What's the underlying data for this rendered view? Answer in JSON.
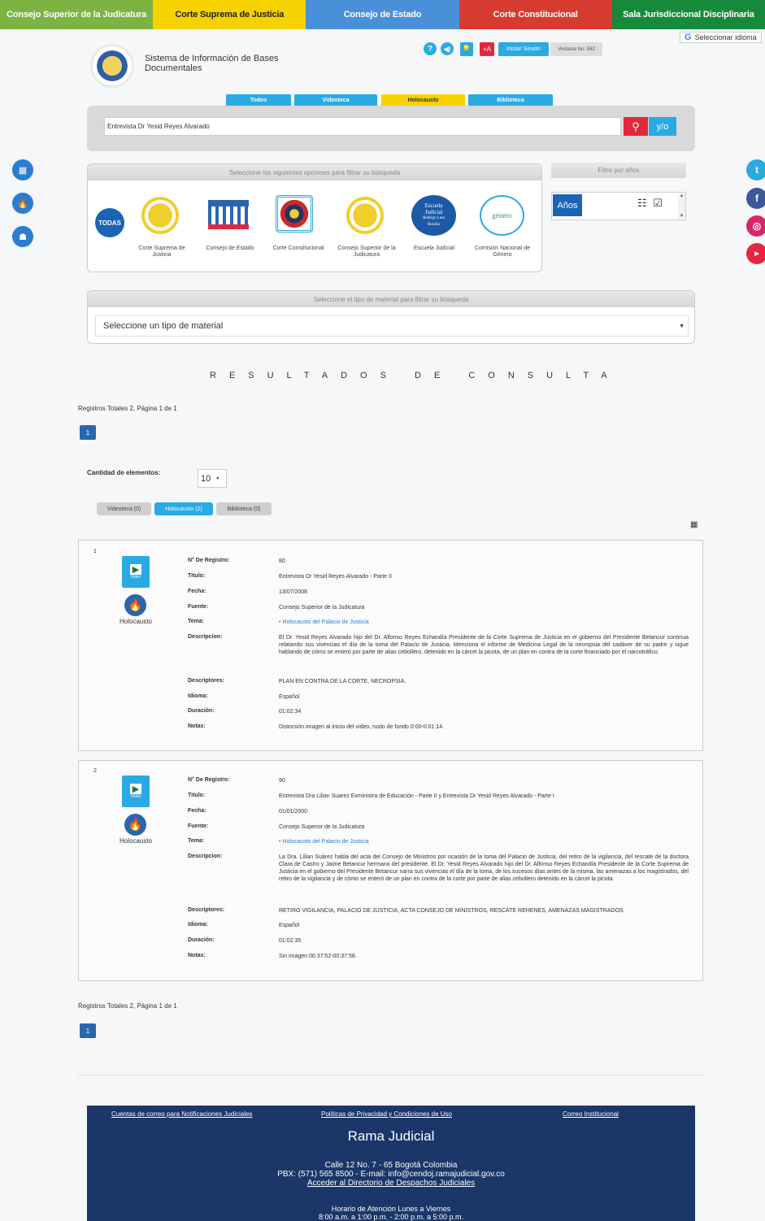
{
  "topbar": [
    {
      "label": "Consejo Superior de la Judicatura",
      "color": "#7cb342"
    },
    {
      "label": "Corte Suprema de Justicia",
      "color": "#f6d200"
    },
    {
      "label": "Consejo de Estado",
      "color": "#4a90d9"
    },
    {
      "label": "Corte Constitucional",
      "color": "#d73a2f"
    },
    {
      "label": "Sala Jurisdiccional Disciplinaria",
      "color": "#168a3a"
    }
  ],
  "lang_selector": "Seleccionar idioma",
  "header": {
    "title_line1": "Sistema de Información de Bases",
    "title_line2": "Documentales"
  },
  "toolbar": {
    "font_btn": "+A",
    "login": "Iniciar Sesión",
    "visitors": "Visitante No: 582"
  },
  "tabs": [
    "Todos",
    "Videoteca",
    "Holocausto",
    "Biblioteca"
  ],
  "search": {
    "value": "Entrevista Dr Yesid Reyes Alvarado",
    "andor": "y/o"
  },
  "filters": {
    "heading": "Seleccione los siguientes opciones para filtrar su búsqueda",
    "all": "TODAS",
    "institutions": [
      "Corte Suprema de Justicia",
      "Consejo de Estado",
      "Corte Constitucional",
      "Consejo Superior de la Judicatura",
      "Escuela Judicial",
      "Comisión Nacional de Género"
    ],
    "escuela_logo": [
      "Escuela",
      "Judicial",
      "Rodrigo Lara",
      "Bonilla"
    ],
    "genero_logo": "género",
    "years_heading": "Filtre por años",
    "years_label": "Años"
  },
  "material": {
    "heading": "Seleccione el tipo de material para filtrar su búsqueda",
    "placeholder": "Seleccione un tipo de material"
  },
  "results": {
    "title": "RESULTADOS DE CONSULTA",
    "summary": "Registros Totales 2, Página 1 de 1",
    "page": "1",
    "qty_label": "Cantidad de elementos:",
    "qty_value": "10",
    "type_tabs": [
      "Videoteca (0)",
      "Holocausto (2)",
      "Biblioteca (0)"
    ],
    "labels": [
      "N° De Registro:",
      "Titulo:",
      "Fecha:",
      "Fuente:",
      "Tema:",
      "Descripcion:",
      "Descriptores:",
      "Idioma:",
      "Duración:",
      "Notas:"
    ],
    "video_label": "Video",
    "category": "Holocausto",
    "items": [
      {
        "num": "1",
        "registro": "80",
        "titulo": "Entrevista Dr Yesid Reyes Alvarado - Parte II",
        "fecha": "13/07/2008",
        "fuente": "Consejo Superior de la Judicatura",
        "tema": "• Holocausto del Palacio de Justicia",
        "descripcion": "El Dr. Yesid Reyes Alvarado hijo del Dr. Alfonso Reyes Echandía Presidente de la Corte Suprema de Justicia en el gobierno del Presidente Betancur continua relatando sus vivencias el día de la toma del Palacio de Justicia. Menciona el informe de Medicina Legal de la necropsia del cadáver de su padre y sigue hablando de cómo se enteró por parte de alias cebollero, detenido en la cárcel la picota, de un plan en contra de la corte financiado por el narcotráfico.",
        "descriptores": "PLAN EN CONTRA DE LA CORTE, NECROPSIA.",
        "idioma": "Español",
        "duracion": "01:02:34",
        "notas": "Distorsión imagen al inicio del video, ruido de fondo 0:00-0:01:14."
      },
      {
        "num": "2",
        "registro": "90",
        "titulo": "Entrevista Dra Lilian Suarez Exministra de Educación - Parte II y Entrevista Dr Yesid Reyes Alvarado - Parte I",
        "fecha": "01/01/2000",
        "fuente": "Consejo Superior de la Judicatura",
        "tema": "• Holocausto del Palacio de Justicia",
        "descripcion": "La Dra. Lilian Suárez habla del acta del Consejo de Ministros por ocasión de la toma del Palacio de Justicia, del retiro de la vigilancia, del rescate de la doctora Clara de Castro y Jaime Betancur hermano del presidente. El Dr. Yesid Reyes Alvarado hijo del Dr. Alfonso Reyes Echandía Presidente de la Corte Suprema de Justicia en el gobierno del Presidente Betancur narra sus vivencias el día de la toma, de los sucesos días antes de la misma, las amenazas a los magistrados, del retiro de la vigilancia y de cómo se enteró de un plan en contra de la corte por parte de alias cebollero detenido en la cárcel la picota.",
        "descriptores": "RETIRO VIGILANCIA, PALACIO DE JUSTICIA, ACTA CONSEJO DE MINISTROS, RESCATE REHENES, AMENAZAS MAGISTRADOS.",
        "idioma": "Español",
        "duracion": "01:02:35",
        "notas": "Sin imagen 00:37:52-00:37:58."
      }
    ]
  },
  "footer": {
    "links": [
      "Cuentas de correo para Notificaciones Judiciales",
      "Políticas de Privacidad y Condiciones de Uso",
      "Correo Institucional"
    ],
    "org": "Rama Judicial",
    "address": "Calle 12 No. 7 - 65 Bogotá Colombia",
    "contact": "PBX: (571) 565 8500 - E-mail: info@cendoj.ramajudicial.gov.co",
    "directory": "Acceder al Directorio de Despachos Judiciales",
    "hours_title": "Horario de Atención Lunes a Viernes",
    "hours": "8:00 a.m. a 1:00 p.m. - 2:00 p.m. a 5:00 p.m."
  },
  "colors": {
    "accent_blue": "#29aae2",
    "holo_yellow": "#f6d200",
    "red": "#e2283d",
    "navy": "#1b3668"
  }
}
